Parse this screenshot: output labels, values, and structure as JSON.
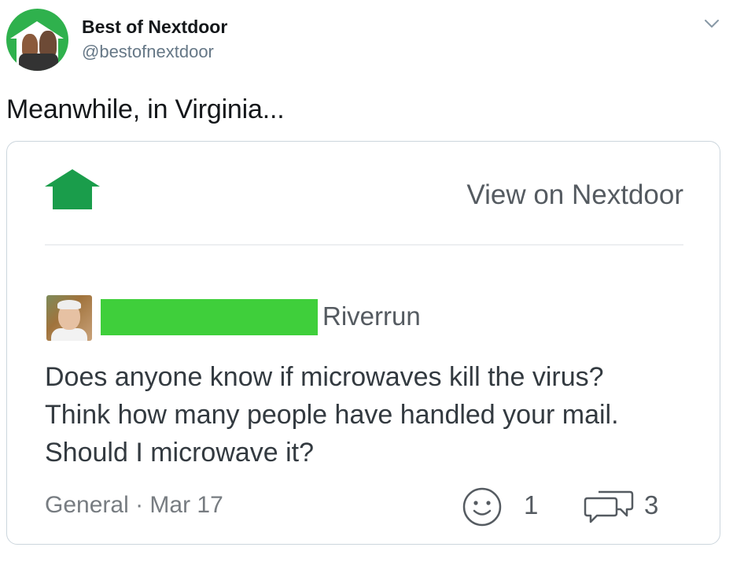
{
  "tweet": {
    "display_name": "Best of Nextdoor",
    "handle": "@bestofnextdoor",
    "text": "Meanwhile, in Virginia...",
    "avatar_icon": "nextdoor-muppets-avatar",
    "menu_icon": "chevron-down-icon"
  },
  "card": {
    "logo_icon": "nextdoor-house-logo",
    "brand_color": "#1a9d4b",
    "view_link": "View on Nextdoor",
    "post": {
      "neighborhood": "Riverrun",
      "redaction_color": "#3fcf3b",
      "body_lines": [
        "Does anyone know if microwaves kill the virus?",
        "Think how many people have handled your mail.",
        "Should I microwave it?"
      ],
      "category": "General",
      "separator": "·",
      "date": "Mar 17",
      "reactions": {
        "icon": "smile-icon",
        "count": "1"
      },
      "comments": {
        "icon": "comment-icon",
        "count": "3"
      }
    }
  }
}
